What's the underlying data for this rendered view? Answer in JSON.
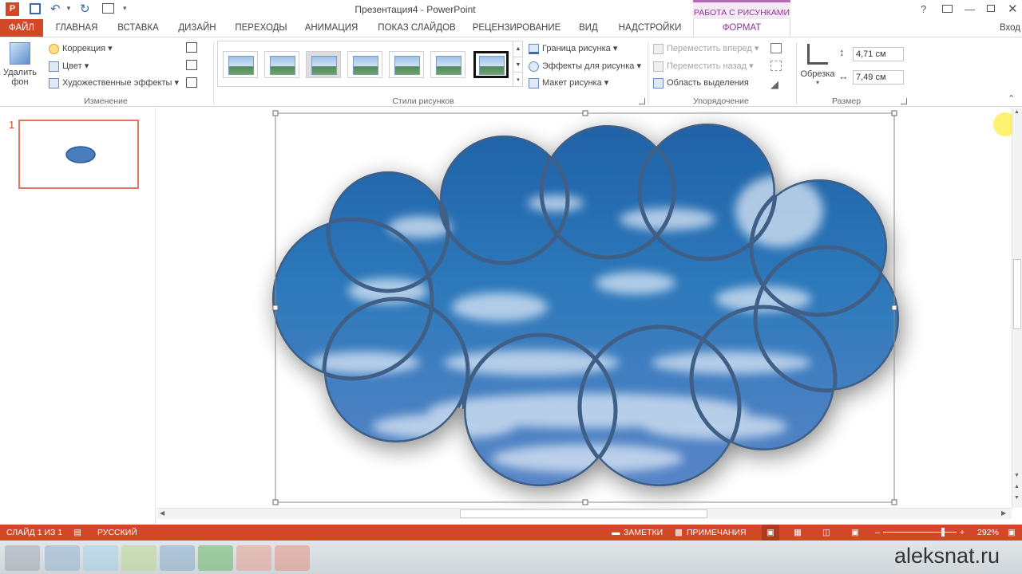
{
  "window": {
    "title": "Презентация4 - PowerPoint",
    "contextual_tab_group": "РАБОТА С РИСУНКАМИ",
    "help": "?",
    "login": "Вход"
  },
  "tabs": [
    {
      "label": "ФАЙЛ"
    },
    {
      "label": "ГЛАВНАЯ"
    },
    {
      "label": "ВСТАВКА"
    },
    {
      "label": "ДИЗАЙН"
    },
    {
      "label": "ПЕРЕХОДЫ"
    },
    {
      "label": "АНИМАЦИЯ"
    },
    {
      "label": "ПОКАЗ СЛАЙДОВ"
    },
    {
      "label": "РЕЦЕНЗИРОВАНИЕ"
    },
    {
      "label": "ВИД"
    },
    {
      "label": "НАДСТРОЙКИ"
    },
    {
      "label": "ФОРМАТ"
    }
  ],
  "ribbon": {
    "remove_bg_line1": "Удалить",
    "remove_bg_line2": "фон",
    "correction": "Коррекция",
    "color": "Цвет",
    "artistic": "Художественные эффекты",
    "group_change": "Изменение",
    "border": "Граница рисунка",
    "effects": "Эффекты для рисунка",
    "layout": "Макет рисунка",
    "group_styles": "Стили рисунков",
    "bring_forward": "Переместить вперед",
    "send_backward": "Переместить назад",
    "selection_pane": "Область выделения",
    "group_arrange": "Упорядочение",
    "crop": "Обрезка",
    "height": "4,71 см",
    "width": "7,49 см",
    "group_size": "Размер"
  },
  "slides": [
    {
      "number": "1"
    }
  ],
  "status": {
    "slide": "СЛАЙД 1 ИЗ 1",
    "language": "РУССКИЙ",
    "notes": "ЗАМЕТКИ",
    "comments": "ПРИМЕЧАНИЯ",
    "zoom": "292%"
  },
  "watermark": "aleksnat.ru",
  "colors": {
    "accent": "#d24726",
    "selected_tab_text": "#d24726",
    "contextual": "#8b3a8b"
  }
}
